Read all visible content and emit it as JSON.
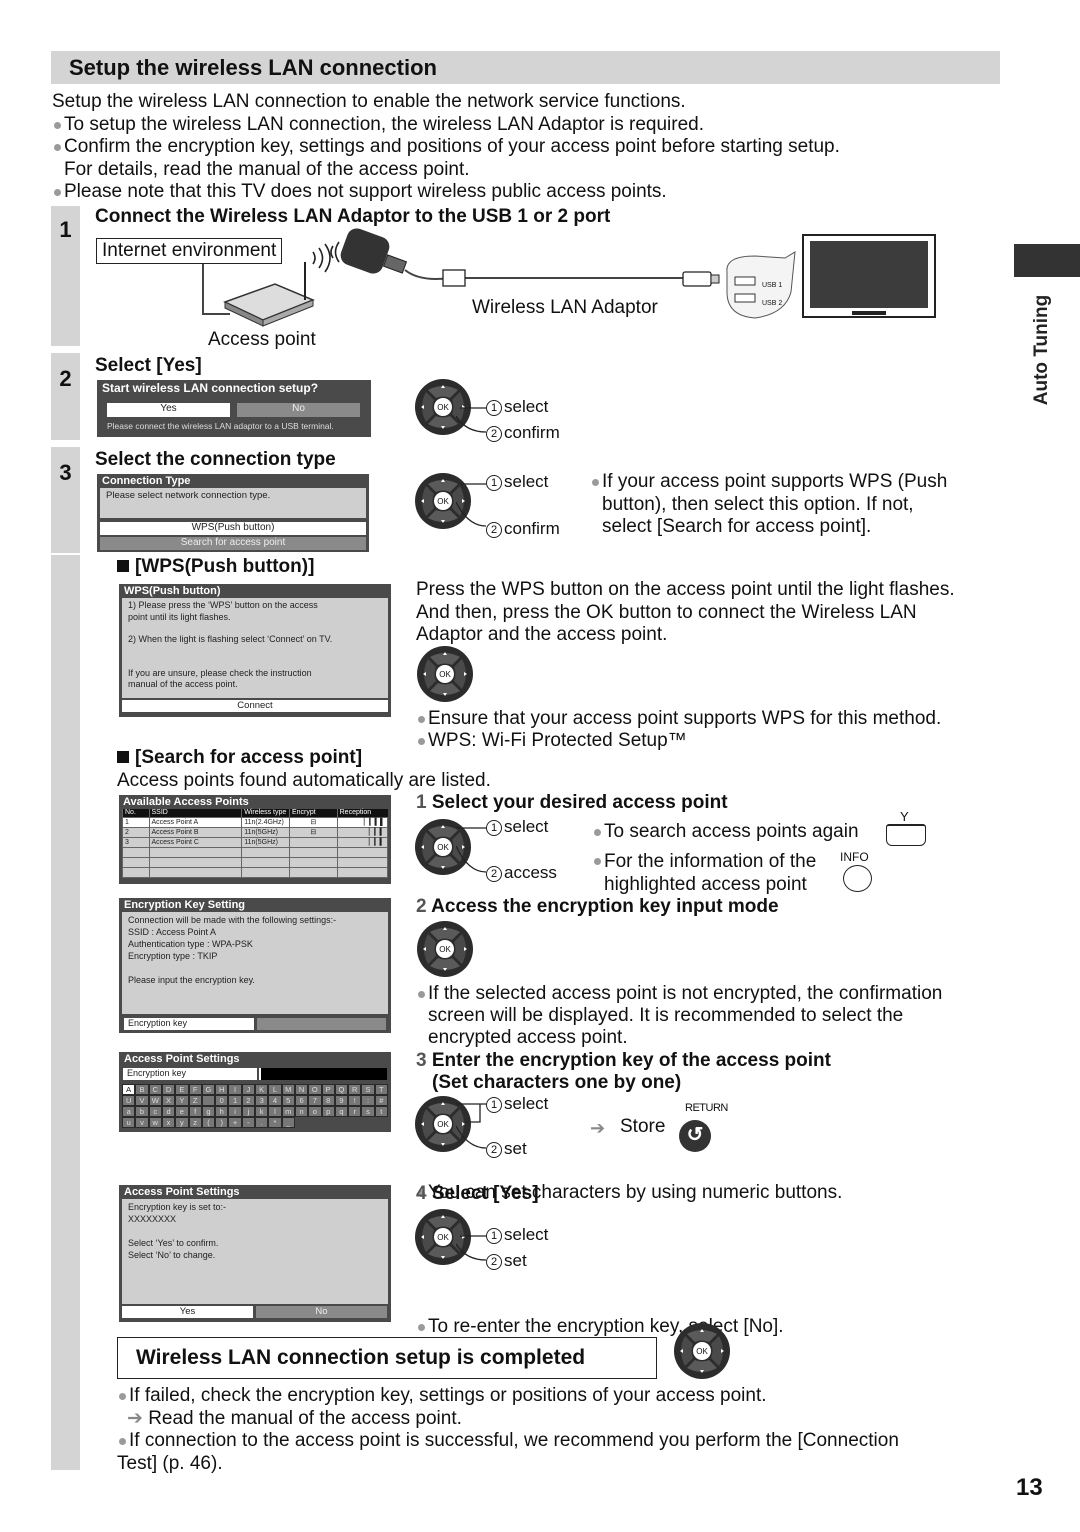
{
  "page": {
    "title": "Setup the wireless LAN connection",
    "page_number": "13",
    "side_tab_label": "Auto Tuning",
    "intro": [
      "Setup the wireless LAN connection to enable the network service functions.",
      "To setup the wireless LAN connection, the wireless LAN Adaptor is required.",
      "Confirm the encryption key, settings and positions of your access point before starting setup.",
      "For details, read the manual of the access point.",
      "Please note that this TV does not support wireless public access points."
    ]
  },
  "step1": {
    "number": "1",
    "heading": "Connect the Wireless LAN Adaptor to the USB 1 or 2 port",
    "internet_label": "Internet environment",
    "access_point_label": "Access point",
    "adaptor_label": "Wireless LAN Adaptor",
    "usb1": "USB 1",
    "usb2": "USB 2"
  },
  "step2": {
    "number": "2",
    "heading": "Select [Yes]",
    "dialog": {
      "title": "Start wireless LAN connection setup?",
      "yes": "Yes",
      "no": "No",
      "note": "Please connect the wireless LAN adaptor to a USB terminal."
    },
    "remote": {
      "ok": "OK",
      "select_num": "1",
      "select": "select",
      "confirm_num": "2",
      "confirm": "confirm"
    }
  },
  "step3": {
    "number": "3",
    "heading": "Select the connection type",
    "dialog": {
      "title": "Connection Type",
      "body": "Please select network connection type.",
      "option_wps": "WPS(Push button)",
      "option_search": "Search for access point"
    },
    "remote": {
      "ok": "OK",
      "select_num": "1",
      "select": "select",
      "confirm_num": "2",
      "confirm": "confirm"
    },
    "note": [
      "If your access point supports WPS (Push",
      "button), then select this option. If not,",
      "select [Search for access point]."
    ]
  },
  "wps": {
    "heading": "[WPS(Push button)]",
    "dialog": {
      "title": "WPS(Push button)",
      "line1": "1) Please press the ‘WPS’ button on the access",
      "line1b": "point until its light flashes.",
      "line2": "2) When the light is flashing select ‘Connect’ on TV.",
      "line3": "If you are unsure, please check the instruction",
      "line3b": "manual of the access point.",
      "button": "Connect"
    },
    "desc": [
      "Press the WPS button on the access point until the light flashes.",
      "And then, press the OK button to connect the Wireless LAN",
      "Adaptor and the access point."
    ],
    "notes": [
      "Ensure that your access point supports WPS for this method.",
      "WPS: Wi-Fi Protected Setup™"
    ],
    "ok": "OK"
  },
  "search": {
    "heading": "[Search for access point]",
    "desc": "Access points found automatically are listed.",
    "ap_dialog": {
      "title": "Available Access Points",
      "columns": [
        "No.",
        "SSID",
        "Wireless type",
        "Encrypt",
        "Reception"
      ],
      "rows": [
        {
          "no": "1",
          "ssid": "Access Point A",
          "type": "11n(2.4GHz)",
          "encrypt": "⊟",
          "reception": "▏▎▍▌"
        },
        {
          "no": "2",
          "ssid": "Access Point B",
          "type": "11n(5GHz)",
          "encrypt": "⊟",
          "reception": "▏▎▍"
        },
        {
          "no": "3",
          "ssid": "Access Point C",
          "type": "11n(5GHz)",
          "encrypt": "",
          "reception": "▏▎▍"
        }
      ]
    },
    "key_dialog": {
      "title": "Encryption Key Setting",
      "lines": [
        "Connection will be made with the following settings:-",
        "SSID : Access Point A",
        "Authentication type : WPA-PSK",
        "Encryption type : TKIP",
        "",
        "Please input the encryption key."
      ],
      "field_label": "Encryption key"
    },
    "kb_dialog": {
      "title": "Access Point Settings",
      "field_label": "Encryption key",
      "keys": [
        "A",
        "B",
        "C",
        "D",
        "E",
        "F",
        "G",
        "H",
        "I",
        "J",
        "K",
        "L",
        "M",
        "N",
        "O",
        "P",
        "Q",
        "R",
        "S",
        "T",
        "U",
        "V",
        "W",
        "X",
        "Y",
        "Z",
        " ",
        "0",
        "1",
        "2",
        "3",
        "4",
        "5",
        "6",
        "7",
        "8",
        "9",
        "!",
        ":",
        "#",
        "a",
        "b",
        "c",
        "d",
        "e",
        "f",
        "g",
        "h",
        "i",
        "j",
        "k",
        "l",
        "m",
        "n",
        "o",
        "p",
        "q",
        "r",
        "s",
        "t",
        "u",
        "v",
        "w",
        "x",
        "y",
        "z",
        "(",
        ")",
        "+",
        "-",
        ".",
        "*",
        "_"
      ]
    },
    "confirm_dialog": {
      "title": "Access Point Settings",
      "lines": [
        "Encryption key is set to:-",
        "XXXXXXXX",
        "",
        "Select ‘Yes’ to confirm.",
        "Select ‘No’ to change."
      ],
      "yes": "Yes",
      "no": "No"
    },
    "substeps": {
      "s1": {
        "num": "1",
        "title": "Select your desired access point",
        "select_num": "1",
        "select": "select",
        "access_num": "2",
        "access": "access",
        "note1": "To search access points again",
        "y_label": "Y",
        "note2a": "For the information of the",
        "note2b": "highlighted access point",
        "info_label": "INFO"
      },
      "s2": {
        "num": "2",
        "title": "Access the encryption key input mode",
        "note": [
          "If the selected access point is not encrypted, the confirmation",
          "screen will be displayed. It is recommended to select the",
          "encrypted access point."
        ]
      },
      "s3": {
        "num": "3",
        "title": "Enter the encryption key of the access point",
        "subtitle": "(Set characters one by one)",
        "select_num": "1",
        "select": "select",
        "set_num": "2",
        "set": "set",
        "store": "Store",
        "return_label": "RETURN",
        "note": "You can set characters by using numeric buttons."
      },
      "s4": {
        "num": "4",
        "title": "Select [Yes]",
        "select_num": "1",
        "select": "select",
        "set_num": "2",
        "set": "set",
        "note": "To re-enter the encryption key, select [No]."
      }
    }
  },
  "completed": {
    "label": "Wireless LAN connection setup is completed",
    "notes": [
      "If failed, check the encryption key, settings or positions of your access point.",
      "Read the manual of the access point.",
      "If connection to the access point is successful, we recommend you perform the [Connection",
      "Test] (p. 46)."
    ]
  },
  "colors": {
    "header_bg": "#d4d4d4",
    "osd_bg": "#4a4a4a",
    "osd_body": "#cfcfcf",
    "side_tab": "#333333"
  }
}
